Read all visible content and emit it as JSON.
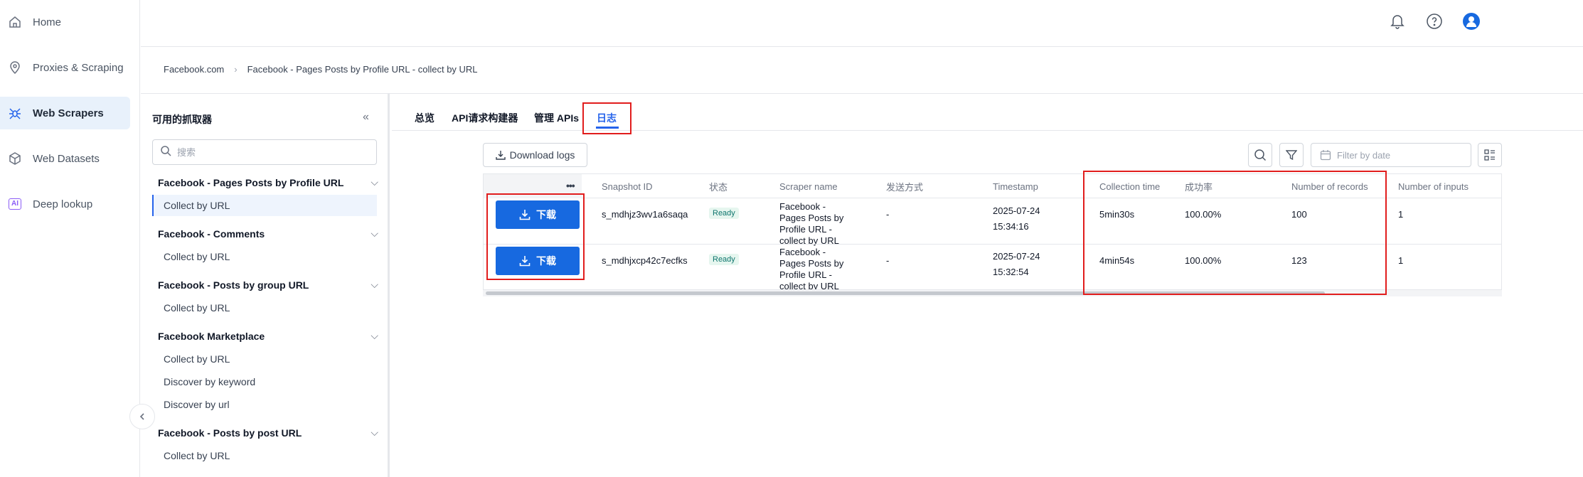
{
  "nav": {
    "items": [
      {
        "label": "Home",
        "icon": "home-icon"
      },
      {
        "label": "Proxies & Scraping",
        "icon": "location-pin-icon"
      },
      {
        "label": "Web Scrapers",
        "icon": "spider-icon"
      },
      {
        "label": "Web Datasets",
        "icon": "cube-icon"
      },
      {
        "label": "Deep lookup",
        "icon": "ai-icon",
        "badge": "AI"
      }
    ],
    "active": "Web Scrapers"
  },
  "topbar": {
    "icons": [
      "bell-icon",
      "help-icon",
      "user-avatar-icon"
    ]
  },
  "breadcrumb": {
    "items": [
      "Facebook.com",
      "Facebook - Pages Posts by Profile URL - collect by URL"
    ],
    "separator": "›"
  },
  "scraper_panel": {
    "title": "可用的抓取器",
    "search_placeholder": "搜索",
    "groups": [
      {
        "name": "Facebook - Pages Posts by Profile URL",
        "items": [
          "Collect by URL"
        ]
      },
      {
        "name": "Facebook - Comments",
        "items": [
          "Collect by URL"
        ]
      },
      {
        "name": "Facebook - Posts by group URL",
        "items": [
          "Collect by URL"
        ]
      },
      {
        "name": "Facebook Marketplace",
        "items": [
          "Collect by URL",
          "Discover by keyword",
          "Discover by url"
        ]
      },
      {
        "name": "Facebook - Posts by post URL",
        "items": [
          "Collect by URL"
        ]
      }
    ]
  },
  "tabs": [
    {
      "label": "总览"
    },
    {
      "label": "API请求构建器"
    },
    {
      "label": "管理 APIs"
    },
    {
      "label": "日志",
      "active": true
    }
  ],
  "toolbar": {
    "download_logs": "Download logs",
    "date_placeholder": "Filter by date"
  },
  "table": {
    "columns": [
      "Snapshot ID",
      "状态",
      "Scraper name",
      "发送方式",
      "Timestamp",
      "Collection time",
      "成功率",
      "Number of records",
      "Number of inputs"
    ],
    "download_label": "下载",
    "rows": [
      {
        "snapshot_id": "s_mdhjz3wv1a6saqa",
        "status": "Ready",
        "scraper_name": [
          "Facebook -",
          "Pages Posts by",
          "Profile URL -",
          "collect by URL"
        ],
        "delivery": "-",
        "timestamp_date": "2025-07-24",
        "timestamp_time": "15:34:16",
        "collection_time": "5min30s",
        "success_rate": "100.00%",
        "records": "100",
        "inputs": "1"
      },
      {
        "snapshot_id": "s_mdhjxcp42c7ecfks",
        "status": "Ready",
        "scraper_name": [
          "Facebook -",
          "Pages Posts by",
          "Profile URL -",
          "collect by URL"
        ],
        "delivery": "-",
        "timestamp_date": "2025-07-24",
        "timestamp_time": "15:32:54",
        "collection_time": "4min54s",
        "success_rate": "100.00%",
        "records": "123",
        "inputs": "1"
      }
    ]
  },
  "colors": {
    "accent": "#2563eb",
    "download_button": "#1769e0",
    "annotation_red": "#e11d1d",
    "ready_badge_bg": "#e6f6ef"
  }
}
